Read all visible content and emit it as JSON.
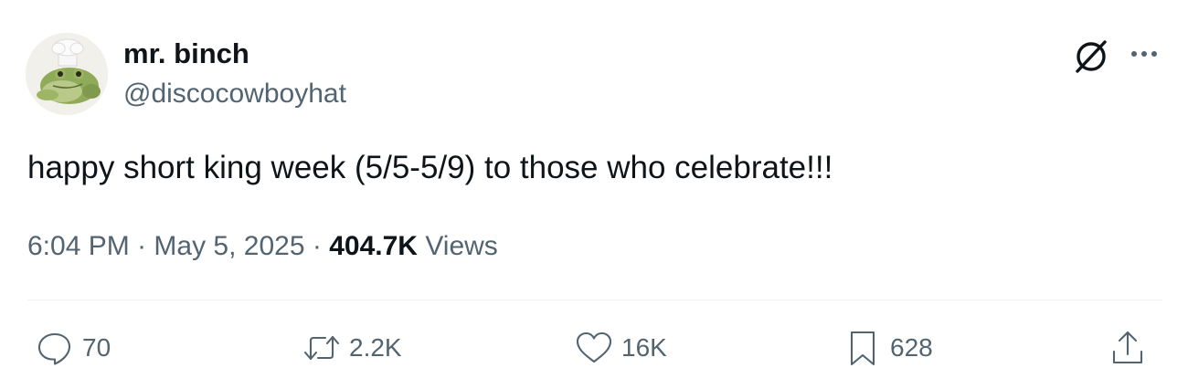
{
  "author": {
    "display_name": "mr. binch",
    "handle": "@discocowboyhat",
    "avatar": "frog-with-chef-hat-avatar"
  },
  "header_icons": [
    "grok-icon",
    "more-options-icon"
  ],
  "tweet": {
    "text": "happy short king week (5/5-5/9) to those who celebrate!!!",
    "time": "6:04 PM",
    "separator": "·",
    "date": "May 5, 2025",
    "views_count": "404.7K",
    "views_label": "Views"
  },
  "actions": {
    "replies": "70",
    "reposts": "2.2K",
    "likes": "16K",
    "bookmarks": "628"
  },
  "colors": {
    "text_primary": "#0f1419",
    "text_secondary": "#536471",
    "divider": "#eff3f4",
    "background": "#ffffff"
  }
}
